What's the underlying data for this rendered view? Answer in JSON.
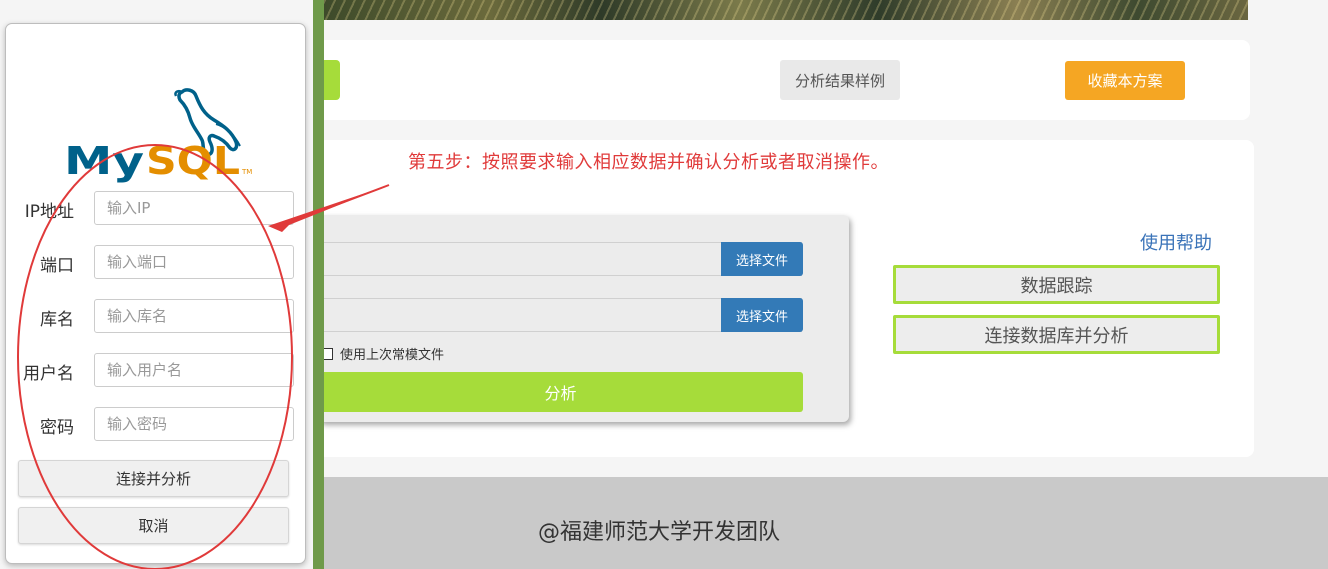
{
  "page": {
    "sample_button": "分析结果样例",
    "favorite_button": "收藏本方案",
    "instruction": "第五步：按照要求输入相应数据并确认分析或者取消操作。",
    "upload": {
      "choose_file_1": "选择文件",
      "choose_file_2": "选择文件",
      "use_last_file": "使用上次常模文件",
      "analyze_button": "分析"
    },
    "help_link": "使用帮助",
    "data_tracking_button": "数据跟踪",
    "connect_db_button": "连接数据库并分析",
    "footer": "@福建师范大学开发团队"
  },
  "modal": {
    "logo_text": "MySQL",
    "fields": [
      {
        "label": "IP地址",
        "placeholder": "输入IP"
      },
      {
        "label": "端口",
        "placeholder": "输入端口"
      },
      {
        "label": "库名",
        "placeholder": "输入库名"
      },
      {
        "label": "用户名",
        "placeholder": "输入用户名"
      },
      {
        "label": "密码",
        "placeholder": "输入密码"
      }
    ],
    "connect_button": "连接并分析",
    "cancel_button": "取消"
  },
  "colors": {
    "accent_green": "#a6dc3a",
    "orange": "#f5a623",
    "blue": "#337ab7",
    "annotation_red": "#e03a3a",
    "mysql_blue": "#00618a",
    "mysql_orange": "#e48e00"
  }
}
